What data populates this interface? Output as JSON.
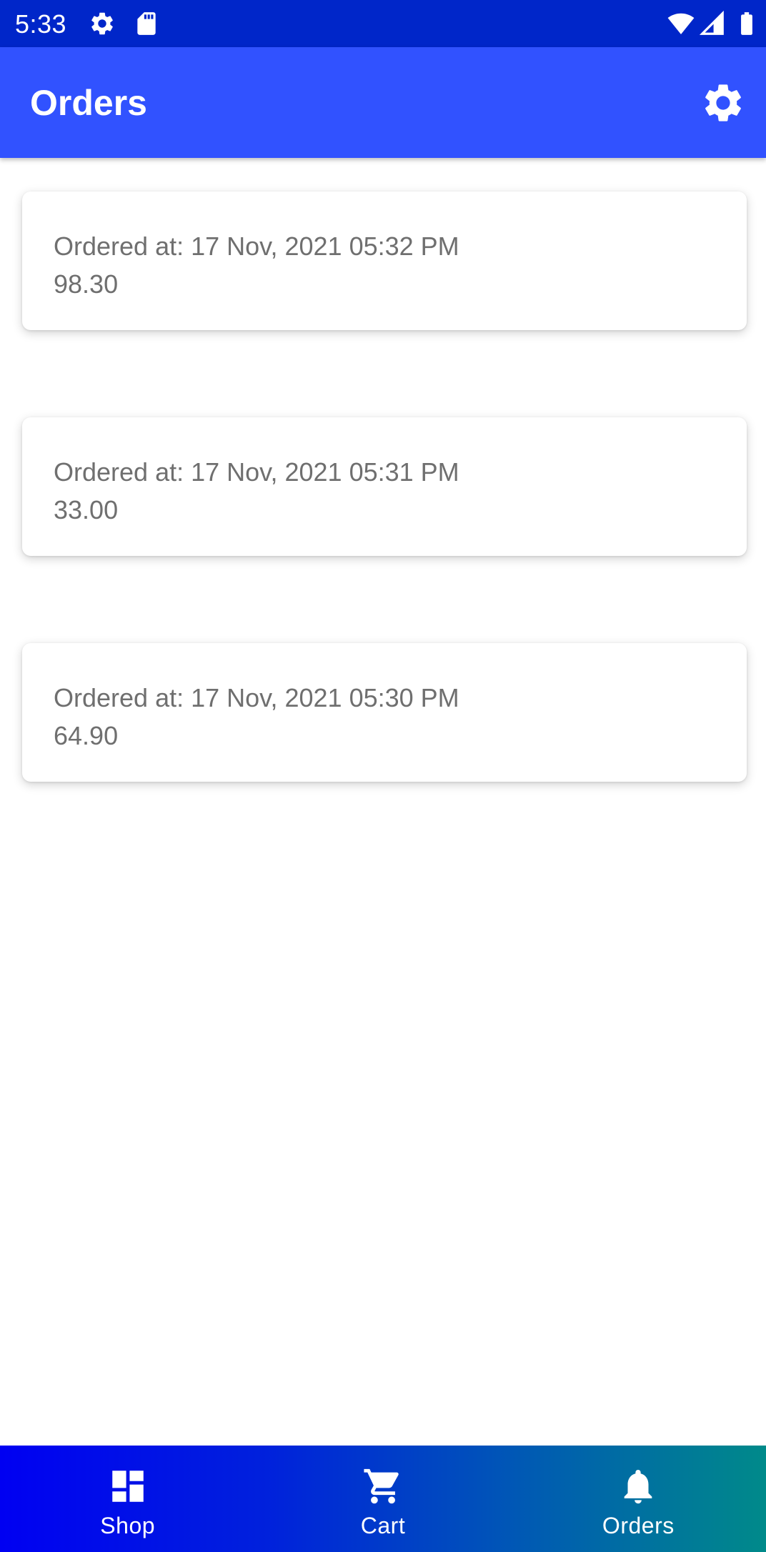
{
  "status_bar": {
    "time": "5:33",
    "icons": [
      "settings-icon",
      "sd-card-icon",
      "wifi-icon",
      "cellular-signal-icon",
      "battery-icon"
    ]
  },
  "app_bar": {
    "title": "Orders",
    "action_icon": "settings-icon"
  },
  "orders": [
    {
      "date_label": "Ordered at: 17 Nov, 2021 05:32 PM",
      "total": "98.30"
    },
    {
      "date_label": "Ordered at: 17 Nov, 2021 05:31 PM",
      "total": "33.00"
    },
    {
      "date_label": "Ordered at: 17 Nov, 2021 05:30 PM",
      "total": "64.90"
    }
  ],
  "bottom_nav": {
    "items": [
      {
        "label": "Shop",
        "icon": "dashboard-icon"
      },
      {
        "label": "Cart",
        "icon": "cart-icon"
      },
      {
        "label": "Orders",
        "icon": "bell-icon"
      }
    ]
  },
  "colors": {
    "status_bar": "#0026c9",
    "app_bar": "#3152ff",
    "nav_gradient_start": "#0000f2",
    "nav_gradient_end": "#008a8a",
    "card_text": "#6f6f6f"
  }
}
